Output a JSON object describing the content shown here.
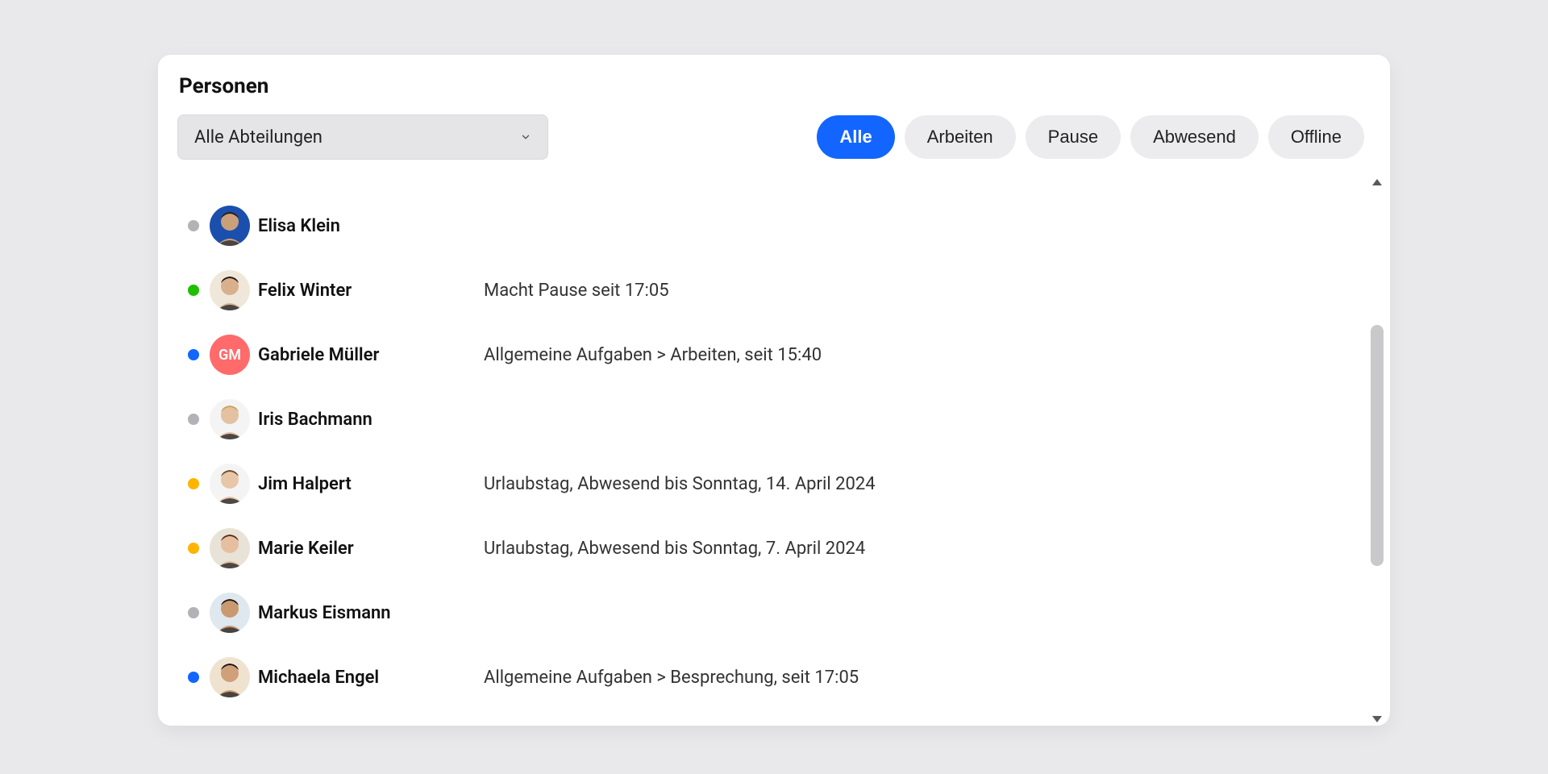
{
  "title": "Personen",
  "select": {
    "value": "Alle Abteilungen"
  },
  "filters": [
    {
      "label": "Alle",
      "active": true
    },
    {
      "label": "Arbeiten",
      "active": false
    },
    {
      "label": "Pause",
      "active": false
    },
    {
      "label": "Abwesend",
      "active": false
    },
    {
      "label": "Offline",
      "active": false
    }
  ],
  "status_colors": {
    "offline": "#b2b3b6",
    "pause": "#1fbf00",
    "working": "#1365ff",
    "absent": "#ffb400"
  },
  "people": [
    {
      "name": "Elisa Klein",
      "status": "offline",
      "detail": "",
      "avatar": {
        "type": "photo",
        "bg": "#1b4fae",
        "skin": "#caa07a",
        "hair": "#2b1a12"
      }
    },
    {
      "name": "Felix Winter",
      "status": "pause",
      "detail": "Macht Pause seit 17:05",
      "avatar": {
        "type": "photo",
        "bg": "#efe8da",
        "skin": "#d8b08c",
        "hair": "#1f1410"
      }
    },
    {
      "name": "Gabriele Müller",
      "status": "working",
      "detail": "Allgemeine Aufgaben > Arbeiten, seit 15:40",
      "avatar": {
        "type": "initials",
        "initials": "GM",
        "bg": "#ff6b6b"
      }
    },
    {
      "name": "Iris Bachmann",
      "status": "offline",
      "detail": "",
      "avatar": {
        "type": "photo",
        "bg": "#f4f4f4",
        "skin": "#e4c1a1",
        "hair": "#caa25a"
      }
    },
    {
      "name": "Jim Halpert",
      "status": "absent",
      "detail": "Urlaubstag, Abwesend bis Sonntag, 14. April 2024",
      "avatar": {
        "type": "photo",
        "bg": "#f4f4f4",
        "skin": "#e8c6a8",
        "hair": "#6b4a2e"
      }
    },
    {
      "name": "Marie Keiler",
      "status": "absent",
      "detail": "Urlaubstag, Abwesend bis Sonntag, 7. April 2024",
      "avatar": {
        "type": "photo",
        "bg": "#e9e2d6",
        "skin": "#e5bfa0",
        "hair": "#5a2f1a"
      }
    },
    {
      "name": "Markus Eismann",
      "status": "offline",
      "detail": "",
      "avatar": {
        "type": "photo",
        "bg": "#dfe7ef",
        "skin": "#c99a70",
        "hair": "#201812"
      }
    },
    {
      "name": "Michaela Engel",
      "status": "working",
      "detail": "Allgemeine Aufgaben > Besprechung, seit 17:05",
      "avatar": {
        "type": "photo",
        "bg": "#efe3d0",
        "skin": "#cfa079",
        "hair": "#1a1210"
      }
    }
  ]
}
